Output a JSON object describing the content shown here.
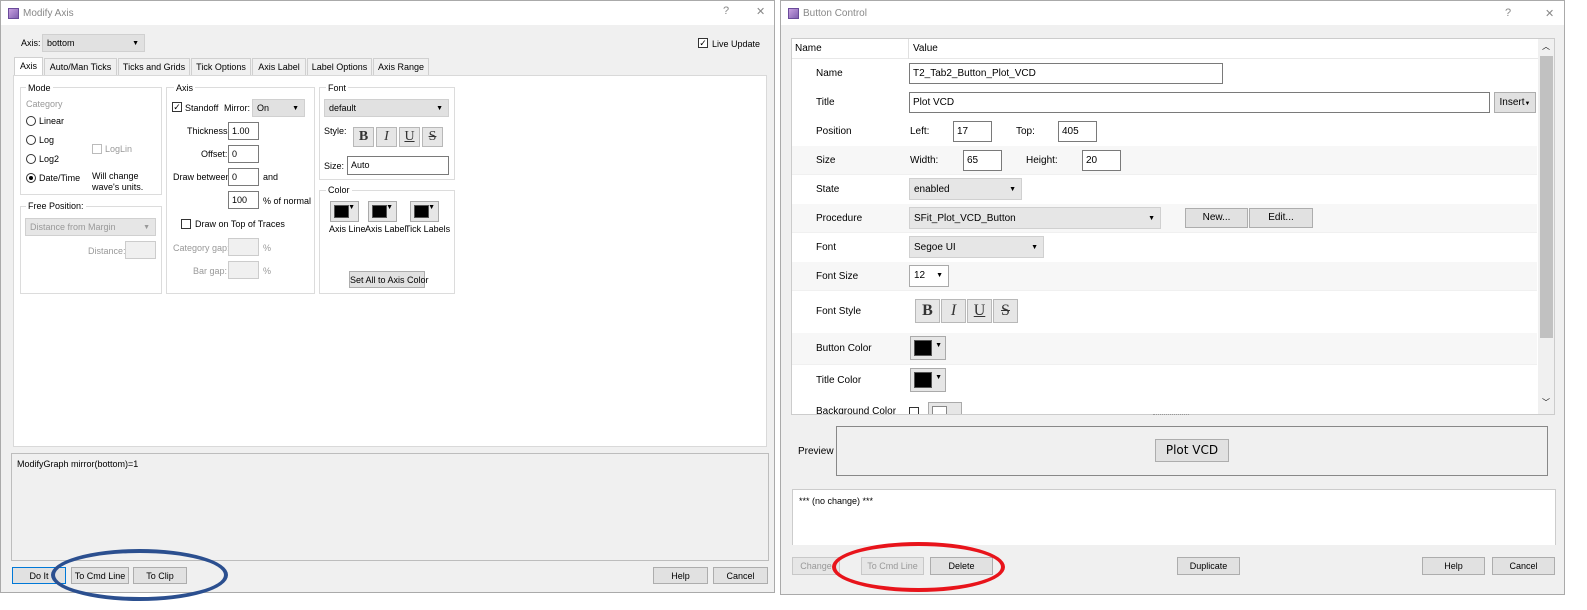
{
  "modify_axis": {
    "title": "Modify Axis",
    "help_icon": "?",
    "close_icon": "✕",
    "axis_label": "Axis:",
    "axis_value": "bottom",
    "live_update": "Live Update",
    "tabs": [
      "Axis",
      "Auto/Man Ticks",
      "Ticks and Grids",
      "Tick Options",
      "Axis Label",
      "Label Options",
      "Axis Range"
    ],
    "mode": {
      "title": "Mode",
      "category": "Category",
      "linear": "Linear",
      "log": "Log",
      "log2": "Log2",
      "datetime": "Date/Time",
      "loglin": "LogLin",
      "note": "Will change wave's units."
    },
    "free_position": {
      "title": "Free Position:",
      "combo": "Distance from Margin",
      "distance": "Distance:"
    },
    "axis": {
      "title": "Axis",
      "standoff": "Standoff",
      "mirror": "Mirror:",
      "mirror_value": "On",
      "thickness": "Thickness:",
      "thickness_value": "1.00",
      "offset": "Offset:",
      "offset_value": "0",
      "draw_between": "Draw between",
      "db_from": "0",
      "and": "and",
      "db_to": "100",
      "pct_normal": "% of normal",
      "draw_on_top": "Draw on Top of Traces",
      "category_gap": "Category gap:",
      "bar_gap": "Bar gap:",
      "pct": "%"
    },
    "font": {
      "title": "Font",
      "font_value": "default",
      "style": "Style:",
      "size": "Size:",
      "size_value": "Auto",
      "b": "B",
      "i": "I",
      "u": "U",
      "s": "S"
    },
    "color": {
      "title": "Color",
      "axis_line": "Axis Line",
      "axis_label": "Axis Label",
      "tick_labels": "Tick Labels",
      "set_all": "Set All to Axis Color"
    },
    "command": "ModifyGraph mirror(bottom)=1",
    "buttons": {
      "do_it": "Do It",
      "to_cmd": "To Cmd Line",
      "to_clip": "To Clip",
      "help": "Help",
      "cancel": "Cancel"
    }
  },
  "button_control": {
    "title": "Button Control",
    "help_icon": "?",
    "close_icon": "✕",
    "col_name": "Name",
    "col_value": "Value",
    "name_label": "Name",
    "name_value": "T2_Tab2_Button_Plot_VCD",
    "title_label": "Title",
    "title_value": "Plot VCD",
    "insert": "Insert",
    "position_label": "Position",
    "left_label": "Left:",
    "left_value": "17",
    "top_label": "Top:",
    "top_value": "405",
    "size_label": "Size",
    "width_label": "Width:",
    "width_value": "65",
    "height_label": "Height:",
    "height_value": "20",
    "state_label": "State",
    "state_value": "enabled",
    "procedure_label": "Procedure",
    "procedure_value": "SFit_Plot_VCD_Button",
    "new": "New...",
    "edit": "Edit...",
    "font_label": "Font",
    "font_value": "Segoe UI",
    "font_size_label": "Font Size",
    "font_size_value": "12",
    "font_style_label": "Font Style",
    "button_color_label": "Button Color",
    "title_color_label": "Title Color",
    "bg_color_label": "Background Color",
    "preview_label": "Preview",
    "preview_button": "Plot VCD",
    "status": "*** (no change) ***",
    "buttons": {
      "change": "Change",
      "to_cmd": "To Cmd Line",
      "delete": "Delete",
      "duplicate": "Duplicate",
      "help": "Help",
      "cancel": "Cancel"
    }
  },
  "colors": {
    "blue_ring": "#2b4f8f",
    "red_ring": "#e8141b"
  }
}
